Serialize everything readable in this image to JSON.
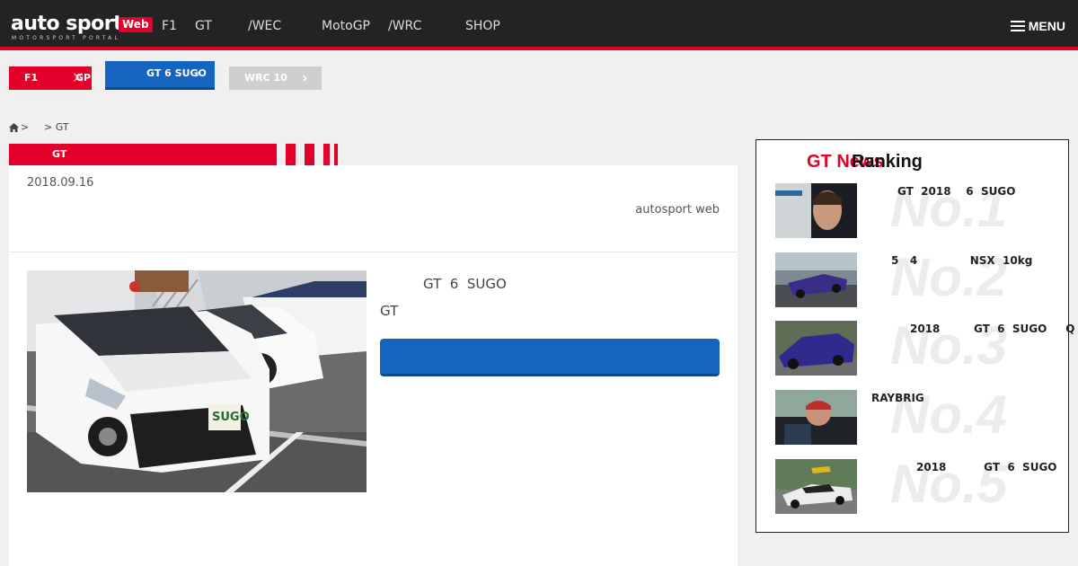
{
  "header": {
    "logo_main": "auto sport",
    "logo_badge": "Web",
    "logo_sub": "MOTORSPORT PORTAL",
    "nav": [
      "F1",
      "GT",
      "/WEC",
      "MotoGP",
      "/WRC",
      "SHOP"
    ],
    "menu_label": "MENU"
  },
  "pickups": [
    {
      "label": "F1",
      "label2": "GP"
    },
    {
      "label": "GT  6  SUGO"
    },
    {
      "label": "WRC  10"
    }
  ],
  "breadcrumb": {
    "home_sep": ">",
    "trail": "> GT"
  },
  "category": {
    "label": "GT"
  },
  "article": {
    "date": "2018.09.16",
    "author": "autosport web",
    "headline": "GT  6  SUGO",
    "subcategory": "GT"
  },
  "ranking": {
    "title_red": "GT News",
    "title_black": "Ranking",
    "items": [
      {
        "no": "No.1",
        "text": "GT  2018    6  SUGO"
      },
      {
        "no": "No.2",
        "text": "5   4              NSX  10kg"
      },
      {
        "no": "No.3",
        "text": "2018         GT  6  SUGO     Q"
      },
      {
        "no": "No.4",
        "text": "RAYBRIG"
      },
      {
        "no": "No.5",
        "text": "2018          GT  6  SUGO"
      }
    ]
  },
  "colors": {
    "brand_red": "#e3002b",
    "brand_blue": "#1565c0",
    "header_bg": "#232323"
  }
}
